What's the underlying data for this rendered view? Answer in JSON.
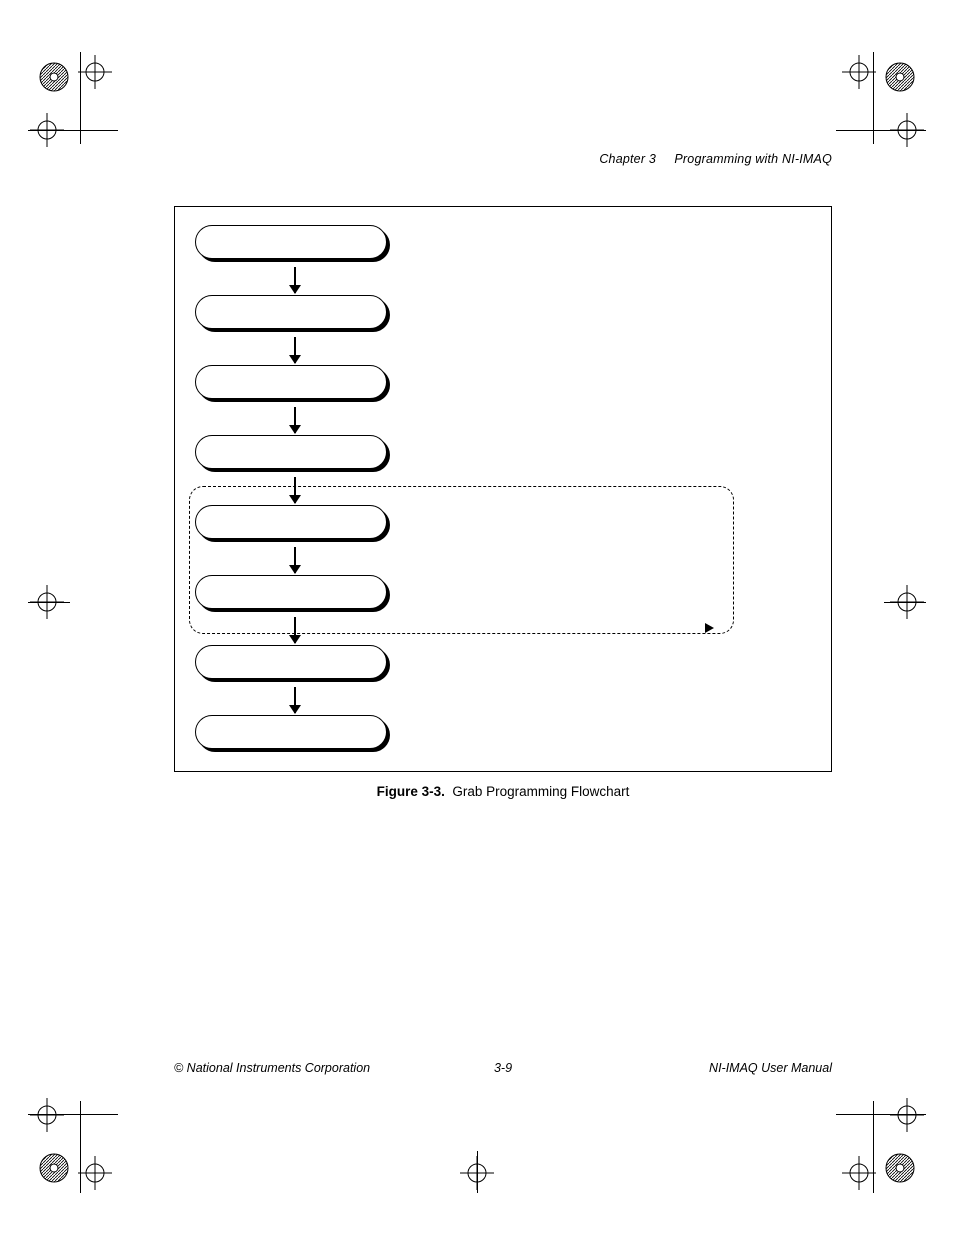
{
  "header": {
    "chapter_label": "Chapter 3",
    "chapter_title": "Programming with NI-IMAQ"
  },
  "figure": {
    "number_label": "Figure 3-3.",
    "title": "Grab Programming Flowchart",
    "loop_label": "",
    "steps": [
      {
        "label": ""
      },
      {
        "label": ""
      },
      {
        "label": ""
      },
      {
        "label": ""
      },
      {
        "label": ""
      },
      {
        "label": ""
      },
      {
        "label": ""
      },
      {
        "label": ""
      }
    ]
  },
  "footer": {
    "copyright": "© National Instruments Corporation",
    "page_number": "3-9",
    "manual_title": "NI-IMAQ User Manual"
  }
}
